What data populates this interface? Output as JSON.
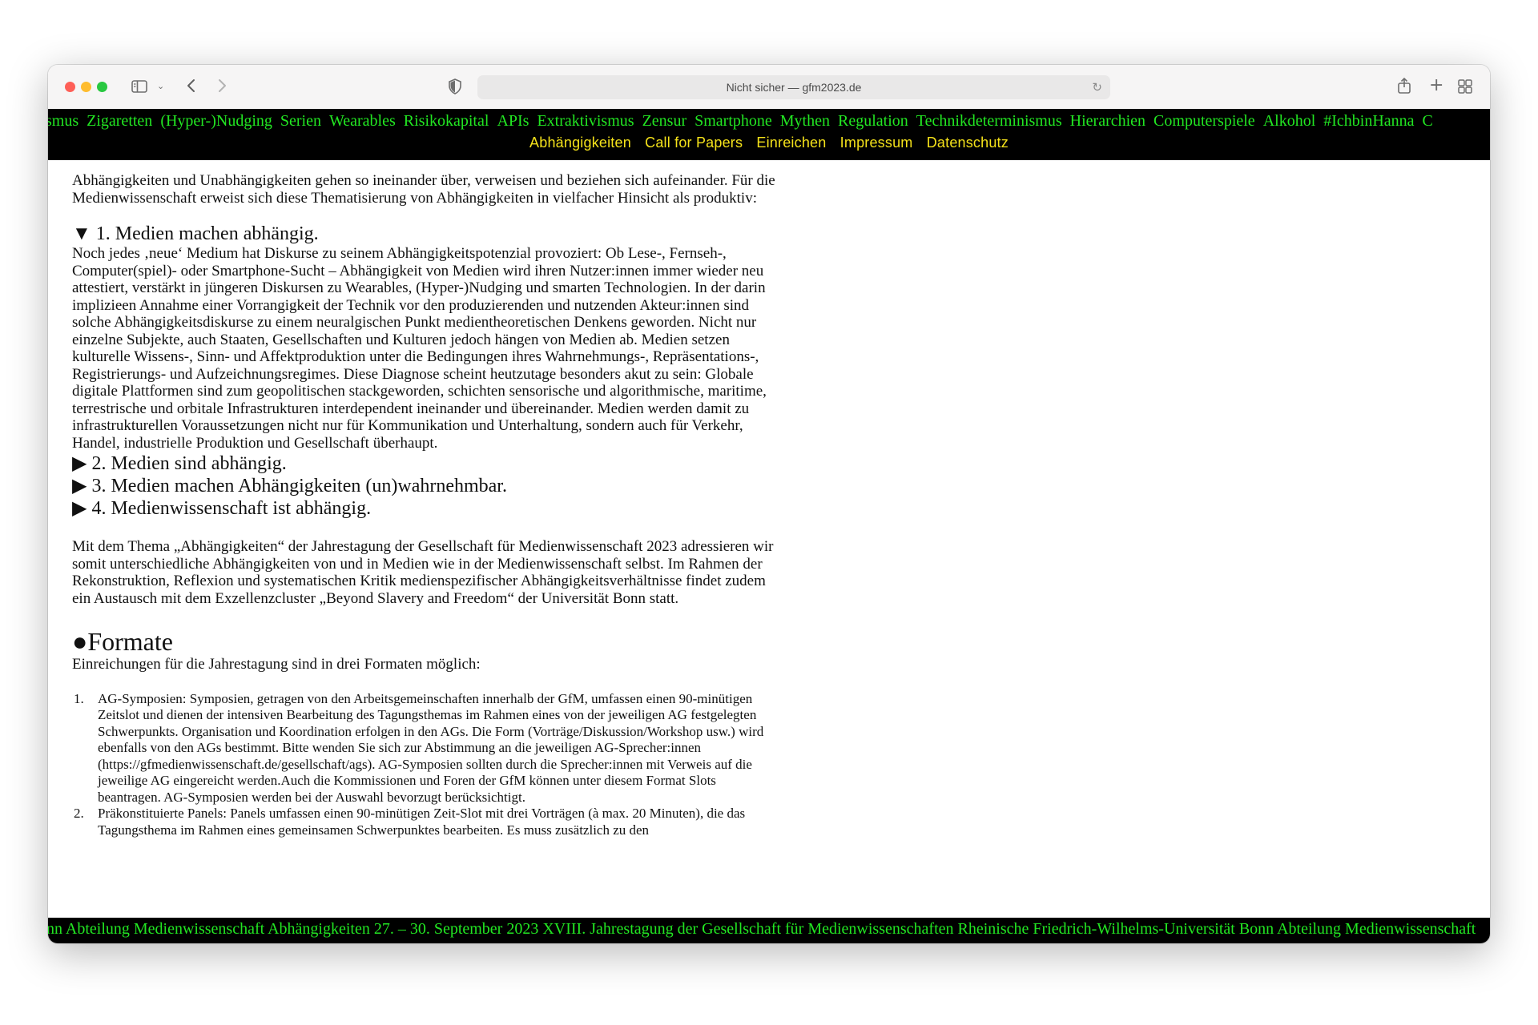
{
  "browser": {
    "url_text": "Nicht sicher — gfm2023.de"
  },
  "ticker_words": [
    "smus",
    "Zigaretten",
    "(Hyper-)Nudging",
    "Serien",
    "Wearables",
    "Risikokapital",
    "APIs",
    "Extraktivismus",
    "Zensur",
    "Smartphone",
    "Mythen",
    "Regulation",
    "Technikdeterminismus",
    "Hierarchien",
    "Computerspiele",
    "Alkohol",
    "#IchbinHanna",
    "C"
  ],
  "nav": [
    "Abhängigkeiten",
    "Call for Papers",
    "Einreichen",
    "Impressum",
    "Datenschutz"
  ],
  "intro": "Abhängigkeiten und Unabhängigkeiten gehen so ineinander über, verweisen und beziehen sich aufeinander. Für die Medienwissenschaft erweist sich diese Thematisierung von Abhängigkeiten in vielfacher Hinsicht als produktiv:",
  "section1": {
    "marker": "▼",
    "title": "1. Medien machen abhängig.",
    "body": "Noch jedes ‚neue‘ Medium hat Diskurse zu seinem Abhängigkeitspotenzial provoziert: Ob Lese-, Fernseh-, Computer(spiel)- oder Smartphone-Sucht – Abhängigkeit von Medien wird ihren Nutzer:innen immer wieder neu attestiert, verstärkt in jüngeren Diskursen zu Wearables, (Hyper-)Nudging und smarten Technologien. In der darin implizieen Annahme einer Vorrangigkeit der Technik vor den produzierenden und nutzenden Akteur:innen sind solche Abhängigkeitsdiskurse zu einem neuralgischen Punkt medientheoretischen Denkens geworden. Nicht nur einzelne Subjekte, auch Staaten, Gesellschaften und Kulturen jedoch hängen von Medien ab. Medien setzen kulturelle Wissens-, Sinn- und Affektproduktion unter die Bedingungen ihres Wahrnehmungs-, Repräsentations-, Registrierungs- und Aufzeichnungsregimes. Diese Diagnose scheint heutzutage besonders akut zu sein: Globale digitale Plattformen sind zum geopolitischen stackgeworden, schichten sensorische und algorithmische, maritime, terrestrische und orbitale Infrastrukturen interdependent ineinander und übereinander. Medien werden damit zu infrastrukturellen Voraussetzungen nicht nur für Kommunikation und Unterhaltung, sondern auch für Verkehr, Handel, industrielle Produktion und Gesellschaft überhaupt."
  },
  "collapsed_sections": [
    {
      "marker": "▶",
      "title": "2. Medien sind abhängig."
    },
    {
      "marker": "▶",
      "title": "3. Medien machen Abhängigkeiten (un)wahrnehmbar."
    },
    {
      "marker": "▶",
      "title": "4. Medienwissenschaft ist abhängig."
    }
  ],
  "outro": "Mit dem Thema „Abhängigkeiten“ der Jahrestagung der Gesellschaft für Medienwissenschaft 2023 adressieren wir somit unterschiedliche Abhängigkeiten von und in Medien wie in der Medienwissenschaft selbst. Im Rahmen der Rekonstruktion, Reflexion und systematischen Kritik medienspezifischer Abhängigkeitsverhältnisse findet zudem ein Austausch mit dem Exzellenzcluster „Beyond Slavery and Freedom“ der Universität Bonn statt.",
  "formate": {
    "heading": "●Formate",
    "lead": "Einreichungen für die Jahrestagung sind in drei Formaten möglich:",
    "items": [
      {
        "num": "1.",
        "text": "AG-Symposien: Symposien, getragen von den Arbeitsgemeinschaften innerhalb der GfM, umfassen einen 90-minütigen Zeitslot und dienen der intensiven Bearbeitung des Tagungsthemas im Rahmen eines von der jeweiligen AG festgelegten Schwerpunkts. Organisation und Koordination erfolgen in den AGs. Die Form (Vorträge/Diskussion/Workshop usw.) wird ebenfalls von den AGs bestimmt. Bitte wenden Sie sich zur Abstimmung an die jeweiligen AG-Sprecher:innen (https://gfmedienwissenschaft.de/gesellschaft/ags). AG-Symposien sollten durch die Sprecher:innen mit Verweis auf die jeweilige AG eingereicht werden.Auch die Kommissionen und Foren der GfM können unter diesem Format Slots beantragen. AG-Symposien werden bei der Auswahl bevorzugt berücksichtigt."
      },
      {
        "num": "2.",
        "text": "Präkonstituierte Panels: Panels umfassen einen 90-minütigen Zeit-Slot mit drei Vorträgen (à max. 20 Minuten), die das Tagungsthema im Rahmen eines gemeinsamen Schwerpunktes bearbeiten. Es muss zusätzlich zu den"
      }
    ]
  },
  "footer_ticker": "nn Abteilung Medienwissenschaft  Abhängigkeiten 27. – 30. September 2023 XVIII. Jahrestagung der Gesellschaft für Medienwissenschaften Rheinische Friedrich-Wilhelms-Universität Bonn Abteilung Medienwissenschaft"
}
